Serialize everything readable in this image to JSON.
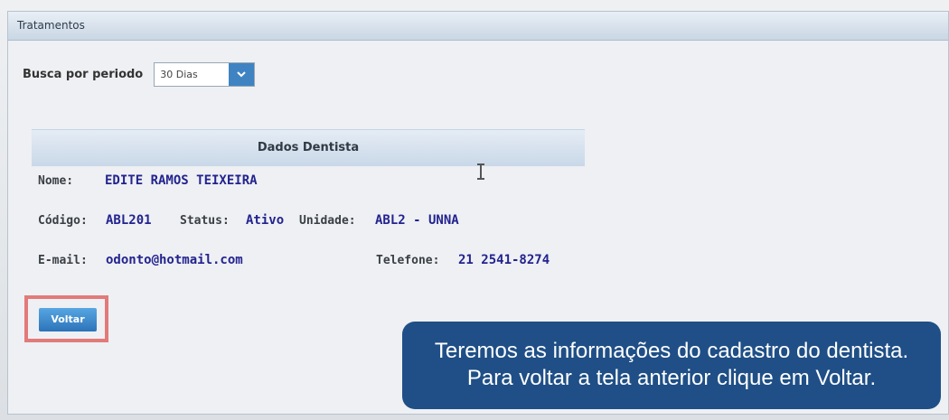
{
  "panel": {
    "title": "Tratamentos"
  },
  "search": {
    "label": "Busca por periodo",
    "selected": "30 Dias"
  },
  "dentist": {
    "section_title": "Dados Dentista",
    "name_label": "Nome:",
    "name": "EDITE RAMOS TEIXEIRA",
    "code_label": "Código:",
    "code": "ABL201",
    "status_label": "Status:",
    "status": "Ativo",
    "unit_label": "Unidade:",
    "unit": "ABL2 - UNNA",
    "email_label": "E-mail:",
    "email": "odonto@hotmail.com",
    "phone_label": "Telefone:",
    "phone": "21 2541-8274"
  },
  "actions": {
    "back_label": "Voltar"
  },
  "tooltip": {
    "line1": "Teremos as informações do cadastro do dentista.",
    "line2": "Para voltar a tela anterior clique em Voltar."
  }
}
